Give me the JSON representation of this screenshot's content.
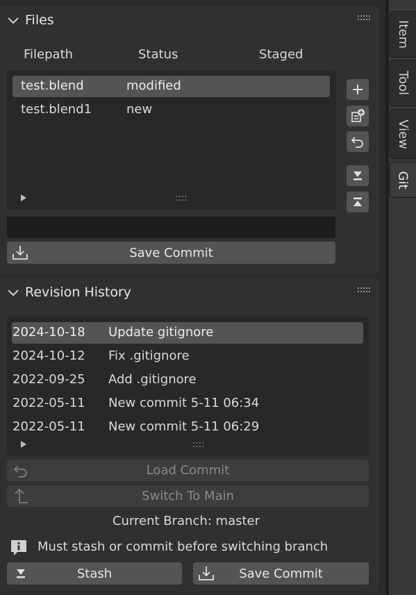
{
  "files_panel": {
    "title": "Files",
    "columns": [
      "Filepath",
      "Status",
      "Staged"
    ],
    "rows": [
      {
        "path": "test.blend",
        "status": "modified"
      },
      {
        "path": "test.blend1",
        "status": "new"
      }
    ],
    "grip_handle": "::::",
    "commit_message_value": "",
    "save_commit_label": "Save Commit",
    "icons": [
      "plus-icon",
      "add-file-icon",
      "undo-icon",
      "move-bottom-icon",
      "move-top-icon"
    ]
  },
  "history_panel": {
    "title": "Revision History",
    "rows": [
      {
        "date": "2024-10-18",
        "message": "Update gitignore"
      },
      {
        "date": "2024-10-12",
        "message": "Fix .gitignore"
      },
      {
        "date": "2022-09-25",
        "message": "Add .gitignore"
      },
      {
        "date": "2022-05-11",
        "message": "New commit 5-11 06:34"
      },
      {
        "date": "2022-05-11",
        "message": "New commit 5-11 06:29"
      }
    ],
    "grip_handle": "::::",
    "load_commit_label": "Load Commit",
    "switch_main_label": "Switch To Main",
    "current_branch": "Current Branch: master",
    "info_message": "Must stash or commit before switching branch",
    "stash_label": "Stash",
    "save_commit_label": "Save Commit"
  },
  "sidebar_tabs": [
    "Item",
    "Tool",
    "View",
    "Git"
  ],
  "active_tab": "Git",
  "colors": {
    "background": "#2a2a2a",
    "panel": "#303030",
    "selected_row": "#545454",
    "button": "#545454",
    "text": "#d9d9d9"
  }
}
